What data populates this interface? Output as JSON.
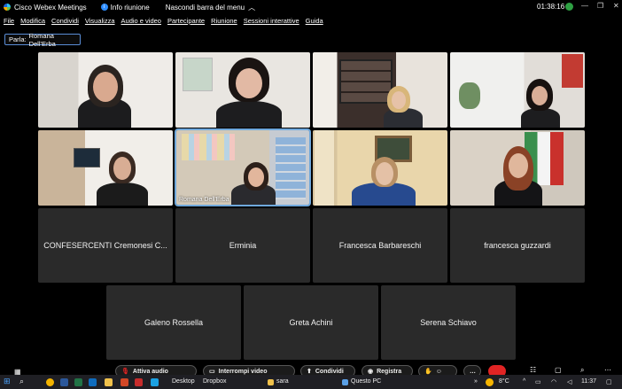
{
  "titlebar": {
    "app": "Cisco Webex Meetings",
    "info": "Info riunione",
    "hide_menu": "Nascondi barra del menu",
    "timer": "01:38:16"
  },
  "menu": [
    "File",
    "Modifica",
    "Condividi",
    "Visualizza",
    "Audio e video",
    "Partecipante",
    "Riunione",
    "Sessioni interattive",
    "Guida"
  ],
  "speaker": {
    "prefix": "Parla:",
    "name": "Romana Dell'Erba"
  },
  "video_tiles": [
    {
      "label": ""
    },
    {
      "label": ""
    },
    {
      "label": ""
    },
    {
      "label": ""
    },
    {
      "label": ""
    },
    {
      "label": "Romana Dell'Erba"
    },
    {
      "label": ""
    },
    {
      "label": ""
    }
  ],
  "name_tiles": [
    "CONFESERCENTI Cremonesi C...",
    "Erminia",
    "Francesca Barbareschi",
    "francesca guzzardi",
    "Galeno Rossella",
    "Greta Achini",
    "Serena Schiavo"
  ],
  "controls": {
    "audio": "Attiva audio",
    "video": "Interrompi video",
    "share": "Condividi",
    "record": "Registra"
  },
  "taskbar": {
    "desktop": "Desktop",
    "dropbox": "Dropbox",
    "sara": "sara",
    "this_pc": "Questo PC",
    "weather": "8°C",
    "clock": "11:37"
  },
  "colors": {
    "accent": "#2d8cff",
    "end_button": "#e02424",
    "tile_bg": "#2a2a2a"
  }
}
